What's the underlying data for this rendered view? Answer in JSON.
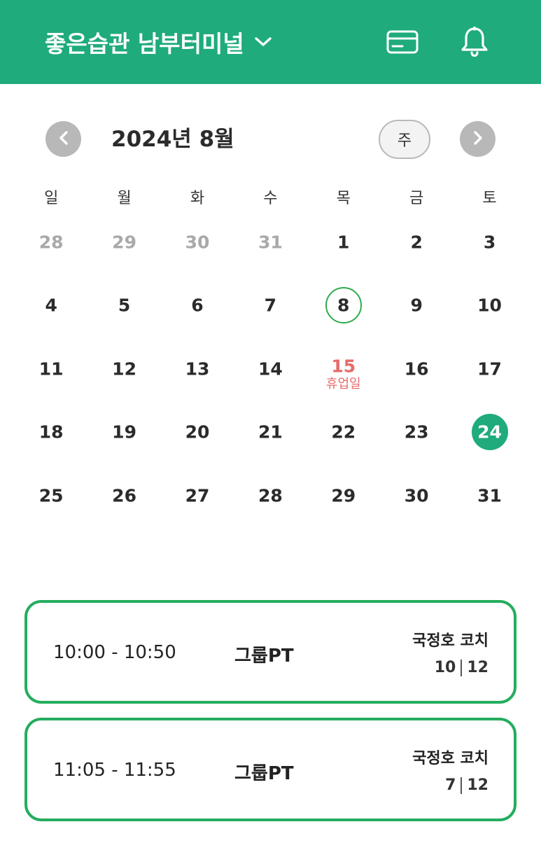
{
  "header": {
    "gym_name": "좋은습관 남부터미널",
    "icons": [
      "chevron-down-icon",
      "credit-card-icon",
      "bell-icon"
    ]
  },
  "calendar": {
    "month_title": "2024년 8월",
    "view_toggle_label": "주",
    "weekdays": [
      "일",
      "월",
      "화",
      "수",
      "목",
      "금",
      "토"
    ],
    "weeks": [
      [
        "28",
        "29",
        "30",
        "31",
        "1",
        "2",
        "3"
      ],
      [
        "4",
        "5",
        "6",
        "7",
        "8",
        "9",
        "10"
      ],
      [
        "11",
        "12",
        "13",
        "14",
        "15",
        "16",
        "17"
      ],
      [
        "18",
        "19",
        "20",
        "21",
        "22",
        "23",
        "24"
      ],
      [
        "25",
        "26",
        "27",
        "28",
        "29",
        "30",
        "31"
      ]
    ],
    "outside_month_days": [
      "28",
      "29",
      "30",
      "31"
    ],
    "today": "8",
    "selected": "24",
    "holiday": {
      "day": "15",
      "label": "휴업일"
    }
  },
  "sessions": [
    {
      "time": "10:00 - 10:50",
      "class_name": "그룹PT",
      "coach": "국정호 코치",
      "booked": "10",
      "capacity": "12"
    },
    {
      "time": "11:05 - 11:55",
      "class_name": "그룹PT",
      "coach": "국정호 코치",
      "booked": "7",
      "capacity": "12"
    }
  ],
  "colors": {
    "brand": "#1fab7c",
    "card_border": "#25ad5e",
    "today_ring": "#2eab4c",
    "holiday": "#e66b6b",
    "muted": "#a9a9a9"
  }
}
